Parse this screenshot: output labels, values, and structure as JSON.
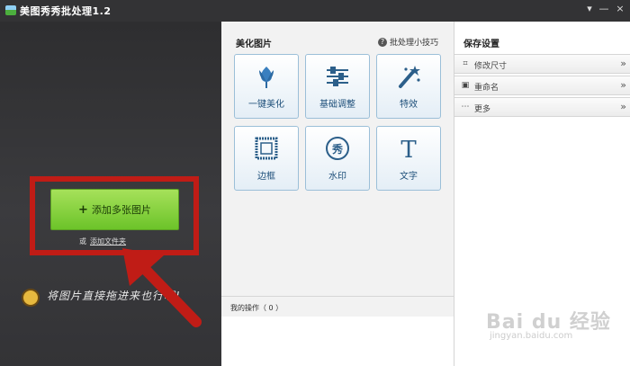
{
  "window": {
    "title": "美图秀秀批处理1.2",
    "controls": {
      "menu": "▾",
      "minimize": "—",
      "close": "×"
    }
  },
  "left_panel": {
    "add_button": {
      "icon": "plus-icon",
      "label": "添加多张图片"
    },
    "or_text": "或",
    "add_folder_link": "添加文件夹",
    "drag_hint": "将图片直接拖进来也行哦!"
  },
  "middle_panel": {
    "title": "美化图片",
    "help_link": "批处理小技巧",
    "tools": [
      {
        "label": "一键美化",
        "icon": "tulip-icon"
      },
      {
        "label": "基础调整",
        "icon": "sliders-icon"
      },
      {
        "label": "特效",
        "icon": "magic-wand-icon"
      },
      {
        "label": "边框",
        "icon": "frame-icon"
      },
      {
        "label": "水印",
        "icon": "stamp-icon",
        "glyph": "秀"
      },
      {
        "label": "文字",
        "icon": "text-icon",
        "glyph": "T"
      }
    ],
    "operations_label": "我的操作（ 0 ）"
  },
  "right_panel": {
    "title": "保存设置",
    "items": [
      {
        "label": "修改尺寸",
        "icon": "crop-icon"
      },
      {
        "label": "重命名",
        "icon": "rename-icon"
      },
      {
        "label": "更多",
        "icon": "more-icon"
      }
    ]
  },
  "watermark": {
    "logo": "Bai du 经验",
    "sub": "jingyan.baidu.com"
  },
  "colors": {
    "accent_green": "#7ccb35",
    "highlight_red": "#c01c16",
    "tool_text": "#1e4f7a",
    "tool_border": "#9bbfd8"
  }
}
